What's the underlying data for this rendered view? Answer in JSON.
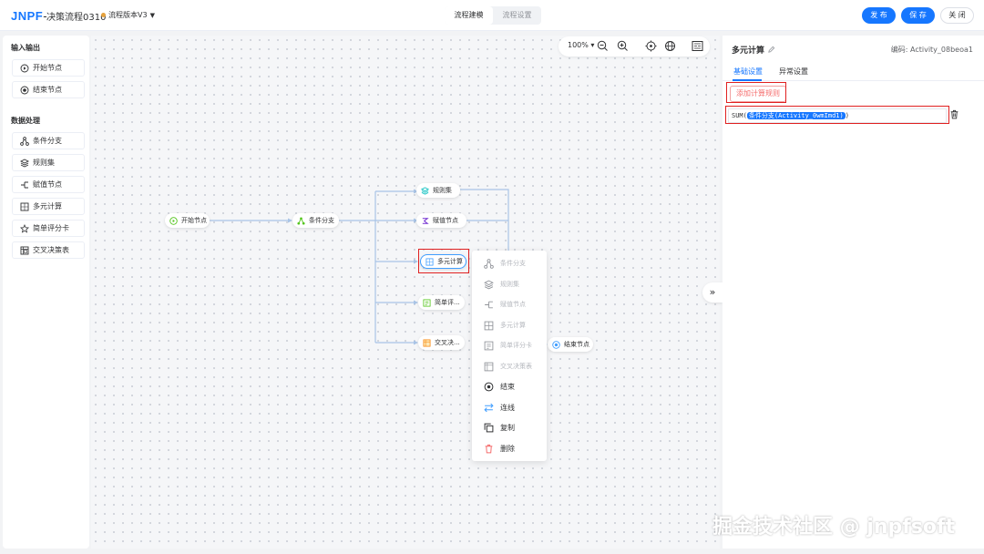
{
  "header": {
    "logo": "JNPF",
    "logo_dash": "-",
    "title": "决策流程0310",
    "version": "流程版本V3",
    "tabs": [
      {
        "label": "流程建模",
        "active": true
      },
      {
        "label": "流程设置",
        "active": false
      }
    ],
    "buttons": {
      "publish": "发 布",
      "save": "保 存",
      "close": "关 闭"
    }
  },
  "palette": {
    "io_title": "输入输出",
    "io_items": [
      {
        "label": "开始节点",
        "icon": "play-circle-icon"
      },
      {
        "label": "结束节点",
        "icon": "stop-circle-icon"
      }
    ],
    "data_title": "数据处理",
    "data_items": [
      {
        "label": "条件分支",
        "icon": "branch-icon"
      },
      {
        "label": "规则集",
        "icon": "layers-icon"
      },
      {
        "label": "赋值节点",
        "icon": "assign-icon"
      },
      {
        "label": "多元计算",
        "icon": "calc-grid-icon"
      },
      {
        "label": "简单评分卡",
        "icon": "star-icon"
      },
      {
        "label": "交叉决策表",
        "icon": "table-icon"
      }
    ]
  },
  "toolbar": {
    "zoom": "100%"
  },
  "flow": {
    "nodes": {
      "start": "开始节点",
      "branch": "条件分支",
      "ruleset": "规则集",
      "assign": "赋值节点",
      "calc": "多元计算",
      "score": "简单评...",
      "cross": "交叉决...",
      "end": "结束节点"
    }
  },
  "context_menu": {
    "disabled_items": [
      "条件分支",
      "规则集",
      "赋值节点",
      "多元计算",
      "简单评分卡",
      "交叉决策表"
    ],
    "enabled_items": [
      "结束",
      "连线",
      "复制",
      "删除"
    ]
  },
  "right_panel": {
    "title": "多元计算",
    "code": "编码: Activity_08beoa1",
    "tabs": [
      "基础设置",
      "异常设置"
    ],
    "add_rule": "添加计算规则",
    "formula_prefix": "SUM(",
    "formula_token": "条件分支(Activity_0wmImd1)",
    "formula_suffix": ")"
  },
  "watermark": "掘金技术社区 @ jnpfsoft",
  "colors": {
    "primary": "#1677ff",
    "danger": "#e02020",
    "edge": "#a9c4e6"
  }
}
